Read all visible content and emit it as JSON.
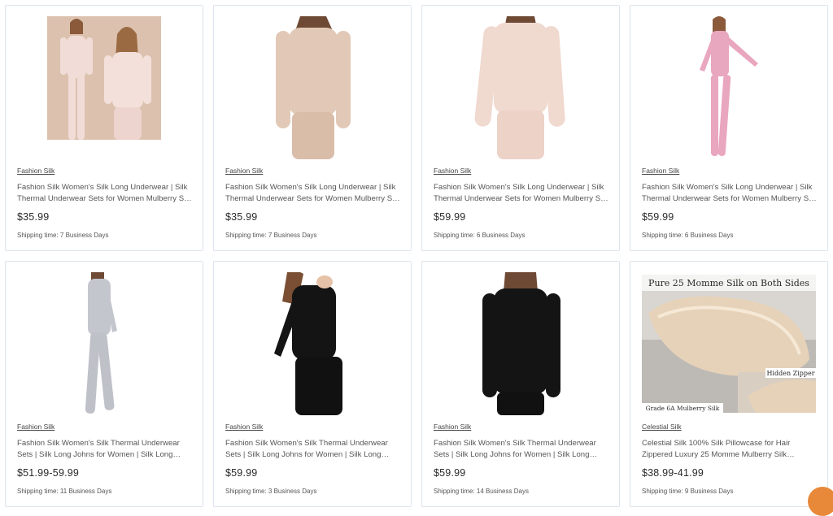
{
  "products": [
    {
      "brand": "Fashion Silk",
      "title": "Fashion Silk Women's Silk Long Underwear | Silk Thermal Underwear Sets for Women Mulberry Silk Long Johns",
      "price": "$35.99",
      "shipping": "Shipping time: 7 Business Days",
      "image": "two-models-silk-set",
      "color": "#f1dcd7"
    },
    {
      "brand": "Fashion Silk",
      "title": "Fashion Silk Women's Silk Long Underwear | Silk Thermal Underwear Sets for Women Mulberry Silk Long Johns",
      "price": "$35.99",
      "shipping": "Shipping time: 7 Business Days",
      "image": "back-view-silk-set",
      "color": "#e2c8b6"
    },
    {
      "brand": "Fashion Silk",
      "title": "Fashion Silk Women's Silk Long Underwear | Silk Thermal Underwear Sets for Women Mulberry Silk Long Johns",
      "price": "$59.99",
      "shipping": "Shipping time: 6 Business Days",
      "image": "back-view-silk-set",
      "color": "#f0d9cf"
    },
    {
      "brand": "Fashion Silk",
      "title": "Fashion Silk Women's Silk Long Underwear | Silk Thermal Underwear Sets for Women Mulberry Silk Long Johns",
      "price": "$59.99",
      "shipping": "Shipping time: 6 Business Days",
      "image": "model-full-body",
      "color": "#e9a6bf"
    },
    {
      "brand": "Fashion Silk",
      "title": "Fashion Silk Women's Silk Thermal Underwear Sets | Silk Long Johns for Women | Silk Long Underwear",
      "price": "$51.99-59.99",
      "shipping": "Shipping time: 11 Business Days",
      "image": "model-full-body",
      "color": "#c4c6ce"
    },
    {
      "brand": "Fashion Silk",
      "title": "Fashion Silk Women's Silk Thermal Underwear Sets | Silk Long Johns for Women | Silk Long Underwear",
      "price": "$59.99",
      "shipping": "Shipping time: 3 Business Days",
      "image": "side-view-silk-set",
      "color": "#141414"
    },
    {
      "brand": "Fashion Silk",
      "title": "Fashion Silk Women's Silk Thermal Underwear Sets | Silk Long Johns for Women | Silk Long Underwear",
      "price": "$59.99",
      "shipping": "Shipping time: 14 Business Days",
      "image": "back-view-silk-set",
      "color": "#141414"
    },
    {
      "brand": "Celestial Silk",
      "title": "Celestial Silk 100% Silk Pillowcase for Hair Zippered Luxury 25 Momme Mulberry Silk Charmeuse Silk Pillowcase",
      "price": "$38.99-41.99",
      "shipping": "Shipping time: 9 Business Days",
      "image": "pillowcase",
      "color": "#e6d2b8",
      "image_text": {
        "headline": "Pure 25 Momme Silk on Both Sides",
        "zipper": "Hidden Zipper",
        "grade": "Grade 6A Mulberry Silk"
      }
    }
  ]
}
